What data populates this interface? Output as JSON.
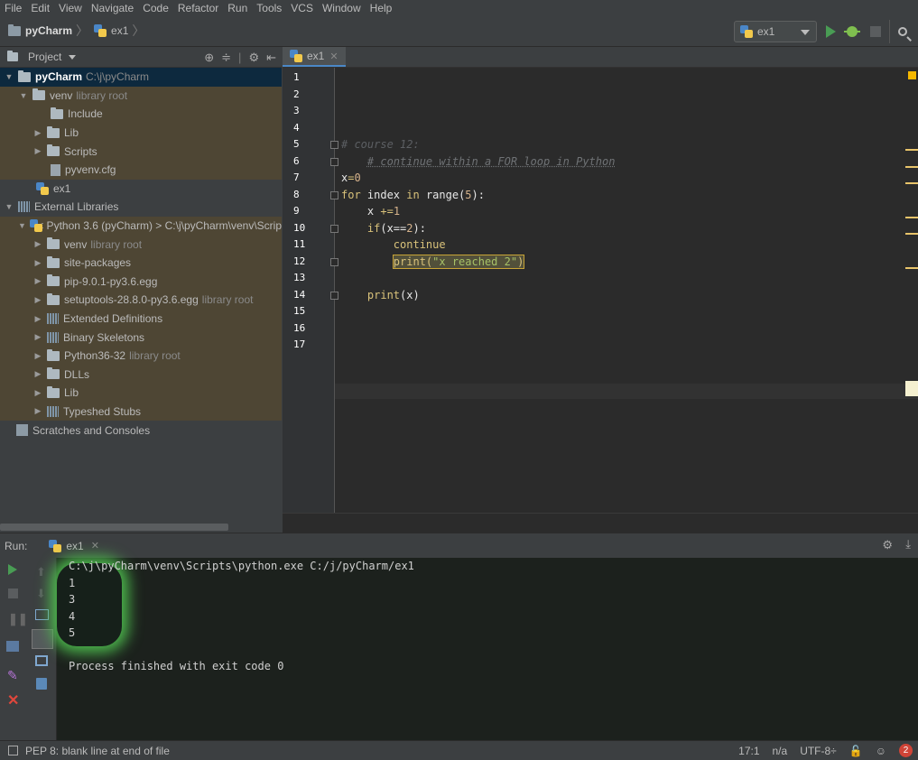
{
  "menu": [
    "File",
    "Edit",
    "View",
    "Navigate",
    "Code",
    "Refactor",
    "Run",
    "Tools",
    "VCS",
    "Window",
    "Help"
  ],
  "navbar": {
    "project": "pyCharm",
    "file": "ex1"
  },
  "run_config": {
    "name": "ex1"
  },
  "project_panel": {
    "title": "Project",
    "tree": [
      {
        "label": "pyCharm",
        "hint": "C:\\j\\pyCharm"
      },
      {
        "label": "venv",
        "hint": "library root"
      },
      {
        "label": "Include",
        "hint": ""
      },
      {
        "label": "Lib",
        "hint": ""
      },
      {
        "label": "Scripts",
        "hint": ""
      },
      {
        "label": "pyvenv.cfg",
        "hint": ""
      },
      {
        "label": "ex1",
        "hint": ""
      },
      {
        "label": "External Libraries",
        "hint": ""
      },
      {
        "label": "< Python 3.6 (pyCharm) > C:\\j\\pyCharm\\venv\\Scrip",
        "hint": ""
      },
      {
        "label": "venv",
        "hint": "library root"
      },
      {
        "label": "site-packages",
        "hint": ""
      },
      {
        "label": "pip-9.0.1-py3.6.egg",
        "hint": ""
      },
      {
        "label": "setuptools-28.8.0-py3.6.egg",
        "hint": "library root"
      },
      {
        "label": "Extended Definitions",
        "hint": ""
      },
      {
        "label": "Binary Skeletons",
        "hint": ""
      },
      {
        "label": "Python36-32",
        "hint": "library root"
      },
      {
        "label": "DLLs",
        "hint": ""
      },
      {
        "label": "Lib",
        "hint": ""
      },
      {
        "label": "Typeshed Stubs",
        "hint": ""
      },
      {
        "label": "Scratches and Consoles",
        "hint": ""
      }
    ]
  },
  "editor": {
    "tab": "ex1",
    "line_numbers": [
      "1",
      "2",
      "3",
      "4",
      "5",
      "6",
      "7",
      "8",
      "9",
      "10",
      "11",
      "12",
      "13",
      "14",
      "15",
      "16",
      "17"
    ],
    "code": {
      "l5": "# course 12:",
      "l6": "# continue within a FOR loop in Python",
      "l7a": "x",
      "l7b": "=",
      "l7c": "0",
      "l8a": "for",
      "l8b": " index ",
      "l8c": "in",
      "l8d": " range(",
      "l8e": "5",
      "l8f": "):",
      "l9a": "x ",
      "l9b": "+=",
      "l9c": "1",
      "l10a": "if",
      "l10b": "(x==",
      "l10c": "2",
      "l10d": "):",
      "l11": "continue",
      "l12a": "print(",
      "l12b": "\"x reached 2\"",
      "l12c": ")",
      "l14a": "print",
      "l14b": "(x)"
    }
  },
  "run_panel": {
    "label": "Run:",
    "tab": "ex1",
    "console": [
      "C:\\j\\pyCharm\\venv\\Scripts\\python.exe C:/j/pyCharm/ex1",
      "1",
      "3",
      "4",
      "5",
      "",
      "Process finished with exit code 0"
    ]
  },
  "status": {
    "message": "PEP 8: blank line at end of file",
    "position": "17:1",
    "na": "n/a",
    "encoding": "UTF-8÷",
    "notifications": "2"
  }
}
